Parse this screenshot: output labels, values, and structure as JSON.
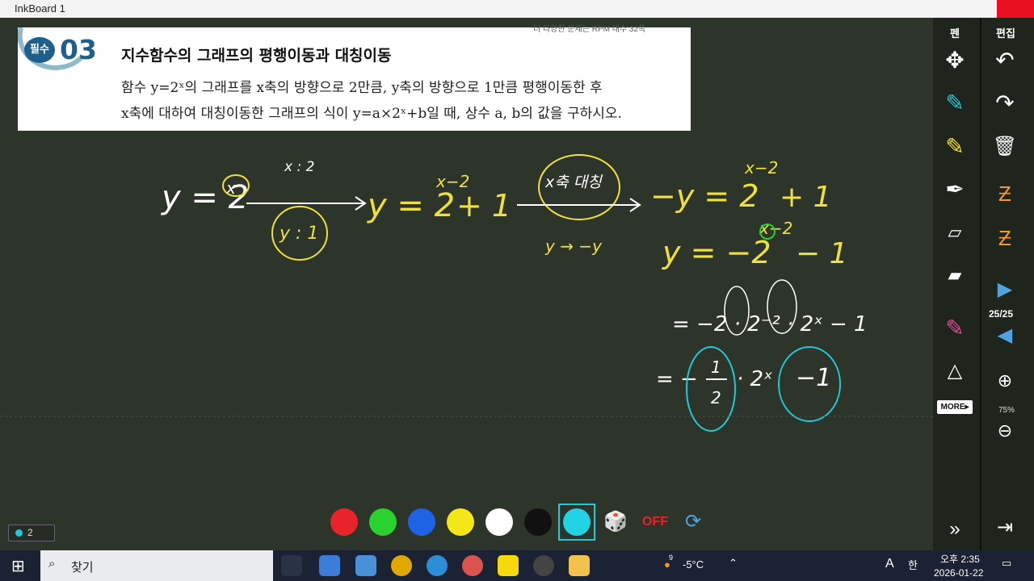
{
  "window": {
    "title": "InkBoard 1"
  },
  "problem": {
    "badge": "필수",
    "number": "03",
    "reference": "더 다양한 문제는 RPM 대수 32쪽",
    "title": "지수함수의 그래프의 평행이동과 대칭이동",
    "line1": "함수 y=2ˣ의 그래프를 x축의 방향으로 2만큼, y축의 방향으로 1만큼 평행이동한 후",
    "line2": "x축에 대하여 대칭이동한 그래프의 식이 y=a×2ˣ+b일 때, 상수 a, b의 값을 구하시오."
  },
  "handwriting": {
    "y_eq_2x": "y = 2",
    "x_exp": "x",
    "shift_x": "x : 2",
    "shift_y": "y : 1",
    "result1": "y = 2",
    "result1_exp": "x−2",
    "result1_plus": "+ 1",
    "reflect_label": "x축 대칭",
    "reflect_rule": "y → −y",
    "neg_eq": "−y = 2",
    "neg_exp": "x−2",
    "neg_plus": "+ 1",
    "step2": "y = −2",
    "step2_exp": "x−2",
    "step2_minus": "− 1",
    "step3": "= −2 · 2⁻² · 2ˣ − 1",
    "step4a": "= −",
    "step4b": "1",
    "step4c": "2",
    "step4d": "· 2ˣ",
    "step4e": "−1"
  },
  "palette": {
    "colors": [
      "#e8232a",
      "#2bd12e",
      "#1e63e6",
      "#f5e61a",
      "#ffffff",
      "#111111",
      "#22d3e6"
    ],
    "selected_index": 6
  },
  "page_indicator": "2",
  "right_panel": {
    "pen_label": "펜",
    "edit_label": "편집",
    "page_count": "25/25",
    "zoom": "75%",
    "more_label": "MORE▸"
  },
  "taskbar": {
    "search_placeholder": "찾기",
    "weather": "-5°C",
    "weather_badge": "9",
    "time": "오후 2:35",
    "date": "2026-01-22",
    "lang": "A",
    "ime": "한"
  }
}
